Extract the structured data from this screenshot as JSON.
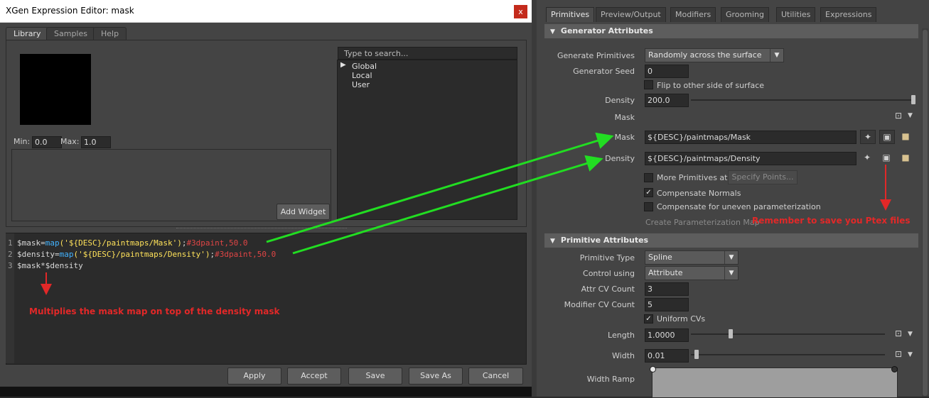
{
  "editor": {
    "title": "XGen Expression Editor: mask",
    "close_glyph": "x",
    "tabs": [
      "Library",
      "Samples",
      "Help"
    ],
    "min_label": "Min:",
    "min_value": "0.0",
    "max_label": "Max:",
    "max_value": "1.0",
    "add_widget": "Add Widget",
    "search_placeholder": "Type to search...",
    "tree": [
      "Global",
      "Local",
      "User"
    ],
    "code_lines": [
      {
        "num": "1",
        "var": "$mask=",
        "fn": "map",
        "str": "('${DESC}/paintmaps/Mask')",
        "tail": ";",
        "cmt": "#3dpaint,50.0"
      },
      {
        "num": "2",
        "var": "$density=",
        "fn": "map",
        "str": "('${DESC}/paintmaps/Density')",
        "tail": ";",
        "cmt": "#3dpaint,50.0"
      },
      {
        "num": "3",
        "var": "$mask*$density",
        "fn": "",
        "str": "",
        "tail": "",
        "cmt": ""
      }
    ],
    "note": "Multiplies the mask map on top of the density mask",
    "buttons": [
      "Apply",
      "Accept",
      "Save",
      "Save As",
      "Cancel"
    ]
  },
  "attr": {
    "tabs": [
      "Primitives",
      "Preview/Output",
      "Modifiers",
      "Grooming",
      "Utilities",
      "Expressions"
    ],
    "gen_section": "Generator Attributes",
    "generate_label": "Generate Primitives",
    "generate_value": "Randomly across the surface",
    "seed_label": "Generator Seed",
    "seed_value": "0",
    "flip_label": "Flip to other side of surface",
    "density_label": "Density",
    "density_value": "200.0",
    "mask_header": "Mask",
    "mask_label": "Mask",
    "mask_value": "${DESC}/paintmaps/Mask",
    "density_map_label": "Density",
    "density_map_value": "${DESC}/paintmaps/Density",
    "more_prims_label": "More Primitives at",
    "specify_points": "Specify Points...",
    "comp_normals": "Compensate Normals",
    "comp_uneven": "Compensate for uneven parameterization",
    "create_param": "Create Parameterization Map",
    "save_note": "Remember to save you Ptex files",
    "prim_section": "Primitive Attributes",
    "ptype_label": "Primitive Type",
    "ptype_value": "Spline",
    "control_label": "Control using",
    "control_value": "Attribute",
    "attrcv_label": "Attr CV Count",
    "attrcv_value": "3",
    "modcv_label": "Modifier CV Count",
    "modcv_value": "5",
    "uniform_label": "Uniform CVs",
    "length_label": "Length",
    "length_value": "1.0000",
    "width_label": "Width",
    "width_value": "0.01",
    "ramp_label": "Width Ramp"
  },
  "colors": {
    "annotation": "#e22828",
    "arrow": "#22dd22"
  }
}
